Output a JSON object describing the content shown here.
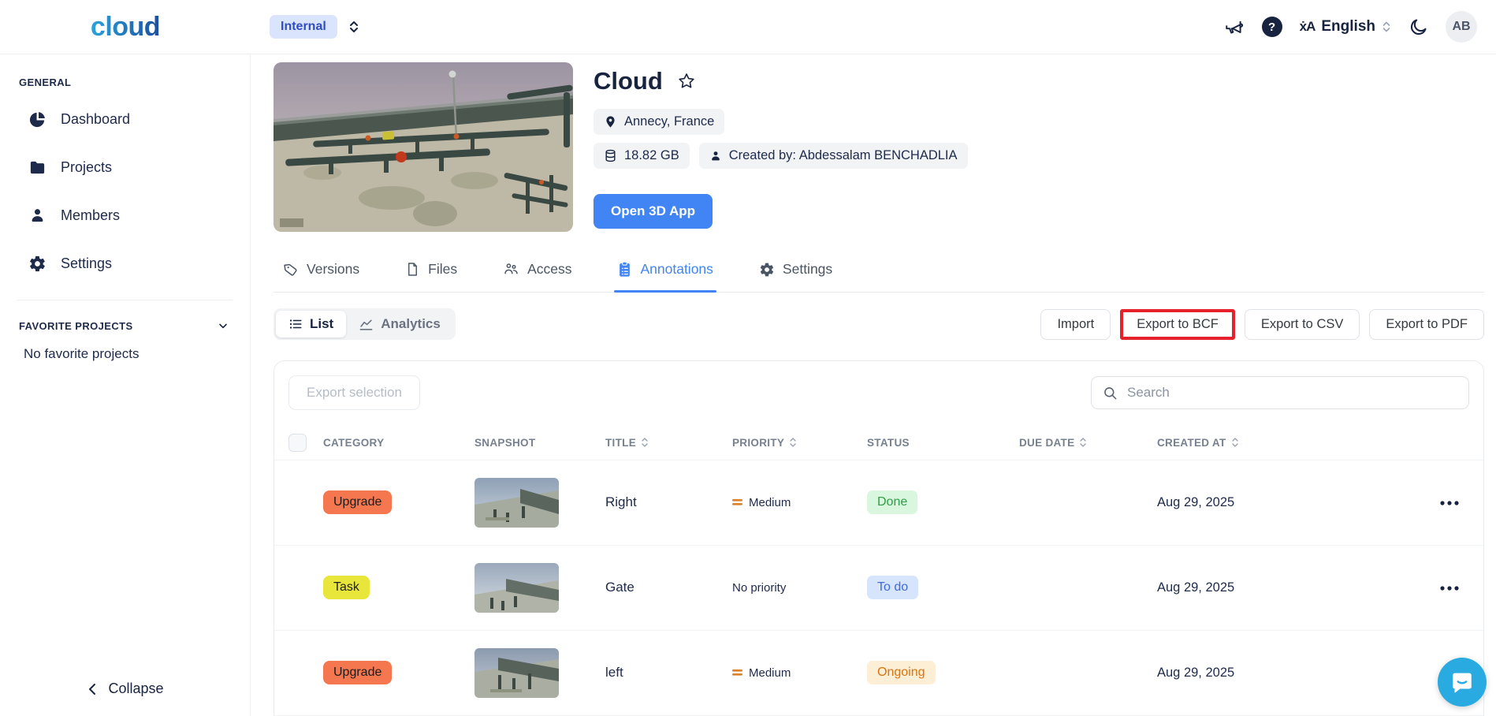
{
  "header": {
    "logo": "cloud",
    "workspace_badge": "Internal",
    "help_glyph": "?",
    "translate_glyph": "ẋA",
    "language": "English",
    "avatar_initials": "AB"
  },
  "sidebar": {
    "general_title": "GENERAL",
    "items": [
      {
        "label": "Dashboard",
        "icon": "pie-chart-icon"
      },
      {
        "label": "Projects",
        "icon": "folder-icon"
      },
      {
        "label": "Members",
        "icon": "person-icon"
      },
      {
        "label": "Settings",
        "icon": "gear-icon"
      }
    ],
    "favorites_title": "FAVORITE PROJECTS",
    "favorites_empty": "No favorite projects",
    "collapse_label": "Collapse"
  },
  "project": {
    "title": "Cloud",
    "location": "Annecy, France",
    "size": "18.82 GB",
    "created_by": "Created by: Abdessalam BENCHADLIA",
    "open_app_label": "Open 3D App"
  },
  "tabs": [
    {
      "label": "Versions"
    },
    {
      "label": "Files"
    },
    {
      "label": "Access"
    },
    {
      "label": "Annotations",
      "active": true
    },
    {
      "label": "Settings"
    }
  ],
  "toolbar": {
    "view_toggle": [
      {
        "label": "List",
        "active": true
      },
      {
        "label": "Analytics",
        "active": false
      }
    ],
    "actions": [
      {
        "label": "Import"
      },
      {
        "label": "Export to BCF",
        "highlighted": true
      },
      {
        "label": "Export to CSV"
      },
      {
        "label": "Export to PDF"
      }
    ],
    "highlight_border": "#e5212b"
  },
  "table": {
    "export_selection_label": "Export selection",
    "search_placeholder": "Search",
    "columns": [
      {
        "label": "CATEGORY",
        "sortable": false
      },
      {
        "label": "SNAPSHOT",
        "sortable": false
      },
      {
        "label": "TITLE",
        "sortable": true
      },
      {
        "label": "PRIORITY",
        "sortable": true
      },
      {
        "label": "STATUS",
        "sortable": false
      },
      {
        "label": "DUE DATE",
        "sortable": true
      },
      {
        "label": "CREATED AT",
        "sortable": true
      }
    ],
    "rows": [
      {
        "category": "Upgrade",
        "category_bg": "#f4774f",
        "category_fg": "#1b1b1b",
        "title": "Right",
        "priority": "Medium",
        "priority_icon_display": "inline-flex",
        "status": "Done",
        "status_bg": "#d9f7df",
        "status_fg": "#2f9e44",
        "due_date": "",
        "created_at": "Aug 29, 2025"
      },
      {
        "category": "Task",
        "category_bg": "#e8e63b",
        "category_fg": "#1b1b1b",
        "title": "Gate",
        "priority": "No priority",
        "priority_icon_display": "none",
        "status": "To do",
        "status_bg": "#d7e5fc",
        "status_fg": "#3f6ad8",
        "due_date": "",
        "created_at": "Aug 29, 2025"
      },
      {
        "category": "Upgrade",
        "category_bg": "#f4774f",
        "category_fg": "#1b1b1b",
        "title": "left",
        "priority": "Medium",
        "priority_icon_display": "inline-flex",
        "status": "Ongoing",
        "status_bg": "#fdeed6",
        "status_fg": "#d9730d",
        "due_date": "",
        "created_at": "Aug 29, 2025"
      }
    ]
  },
  "colors": {
    "accent_blue": "#4185f4",
    "highlight_red": "#e5212b",
    "priority_medium": "#d9822b",
    "chat_bubble": "#29abe2"
  }
}
